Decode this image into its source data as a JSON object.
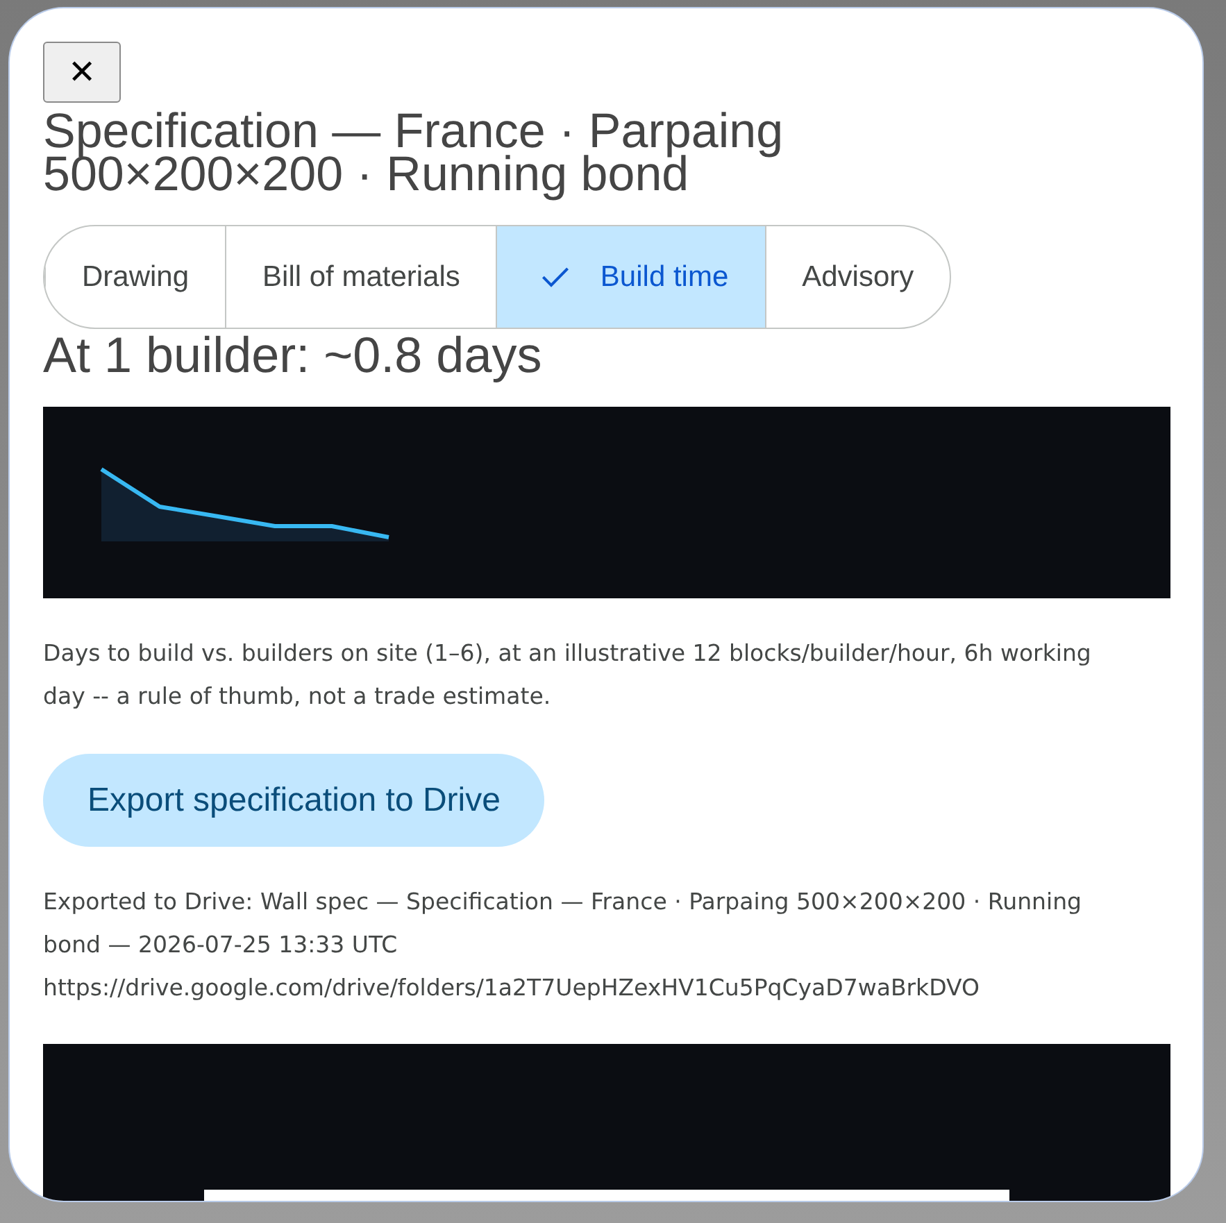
{
  "dialog": {
    "close_button": "✕",
    "title": "Specification — France · Parpaing 500×200×200 · Running bond",
    "tabs": [
      {
        "label": "Drawing",
        "selected": false
      },
      {
        "label": "Bill of materials",
        "selected": false
      },
      {
        "label": "Build time",
        "selected": true
      },
      {
        "label": "Advisory",
        "selected": false
      }
    ],
    "summary": "At 1 builder: ~0.8 days",
    "caption": "Days to build vs. builders on site (1–6), at an illustrative 12 blocks/builder/hour, 6h working day -- a rule of thumb, not a trade estimate.",
    "export_button": "Export specification to Drive",
    "export_status": "Exported to Drive: Wall spec — Specification — France · Parpaing 500×200×200 · Running bond — 2026-07-25 13:33 UTC",
    "export_url": "https://drive.google.com/drive/folders/1a2T7UepHZexHV1Cu5PqCyaD7waBrkDVO"
  }
}
